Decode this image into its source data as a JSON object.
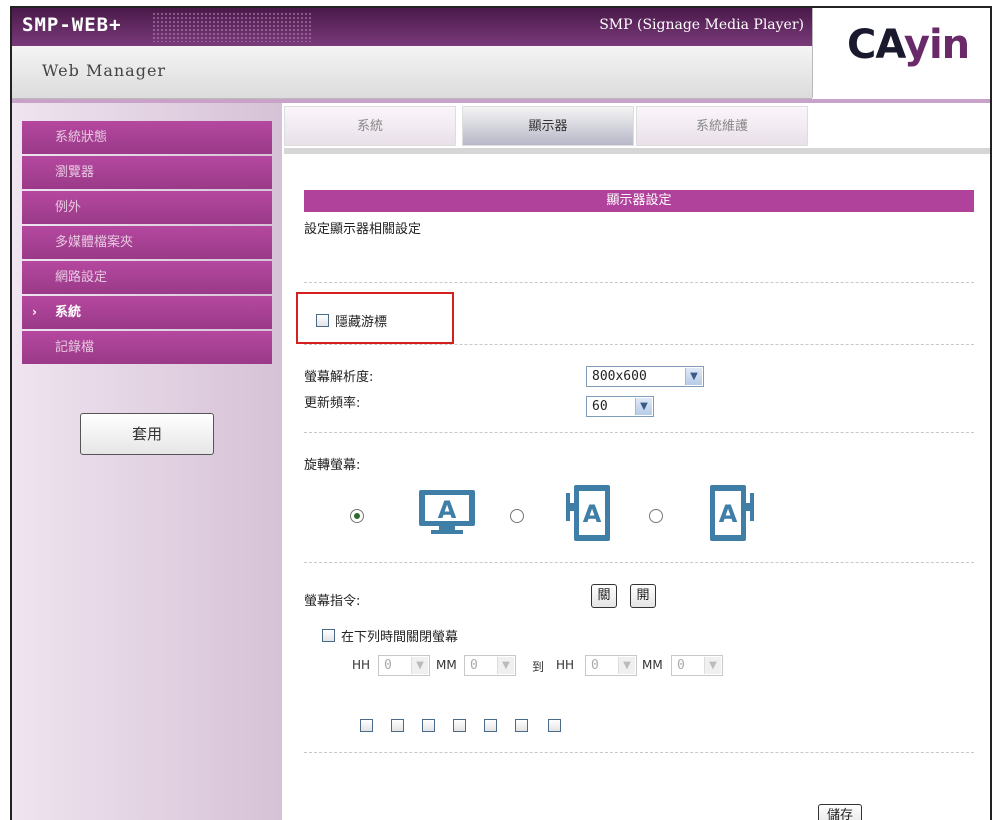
{
  "header": {
    "product": "SMP-WEB+",
    "title": "SMP (Signage Media Player)",
    "subtitle": "Web Manager",
    "brand_main": "CA",
    "brand_accent": "yin"
  },
  "sidebar": {
    "items": [
      {
        "label": "系統狀態",
        "active": false
      },
      {
        "label": "瀏覽器",
        "active": false
      },
      {
        "label": "例外",
        "active": false
      },
      {
        "label": "多媒體檔案夾",
        "active": false
      },
      {
        "label": "網路設定",
        "active": false
      },
      {
        "label": "系統",
        "active": true
      },
      {
        "label": "記錄檔",
        "active": false
      }
    ],
    "active_marker": "›",
    "apply_label": "套用"
  },
  "tabs": [
    {
      "label": "系統",
      "active": false
    },
    {
      "label": "顯示器",
      "active": true
    },
    {
      "label": "系統維護",
      "active": false
    }
  ],
  "display": {
    "section_title": "顯示器設定",
    "section_desc": "設定顯示器相關設定",
    "hide_cursor_label": "隱藏游標",
    "hide_cursor_checked": false,
    "resolution_label": "螢幕解析度:",
    "resolution_value": "800x600",
    "refresh_label": "更新頻率:",
    "refresh_value": "60",
    "rotate_label": "旋轉螢幕:",
    "rotate_selected": "landscape",
    "command_label": "螢幕指令:",
    "off_button": "關",
    "on_button": "開",
    "schedule_label": "在下列時間關閉螢幕",
    "schedule_checked": false,
    "hh_label": "HH",
    "mm_label": "MM",
    "to_label": "到",
    "start_hh": "0",
    "start_mm": "0",
    "end_hh": "0",
    "end_mm": "0",
    "day_checkboxes": 7,
    "save_label": "儲存"
  },
  "colors": {
    "accent": "#b0429c",
    "highlight": "#d41f1f",
    "icon": "#3f7ea6"
  }
}
